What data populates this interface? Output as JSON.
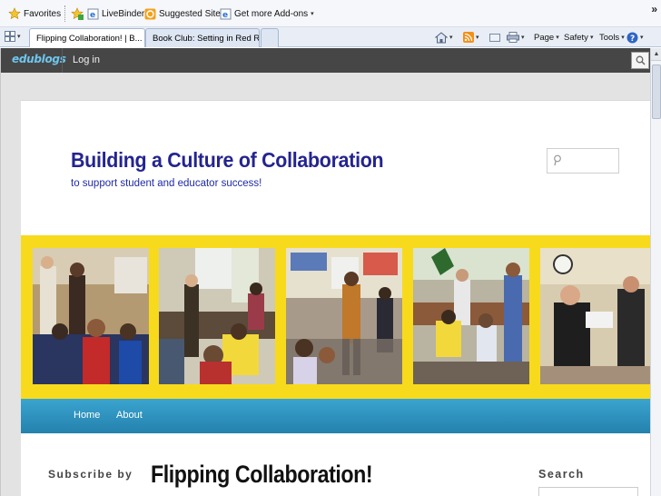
{
  "favorites_bar": {
    "favorites_label": "Favorites",
    "livebinder_label": "LiveBinder It",
    "suggested_sites_label": "Suggested Sites",
    "addons_label": "Get more Add-ons",
    "more_glyph": "»"
  },
  "tabs": [
    {
      "label": "Flipping Collaboration! | B...",
      "close": "✕",
      "active": true
    },
    {
      "label": "Book Club: Setting in Red Ro...",
      "active": false
    }
  ],
  "command_bar": {
    "page_label": "Page",
    "safety_label": "Safety",
    "tools_label": "Tools",
    "dropdown_glyph": "▾"
  },
  "admin_bar": {
    "logo_text": "edublogs",
    "login_label": "Log in"
  },
  "site": {
    "title": "Building a Culture of Collaboration",
    "tagline": "to support student and educator success!",
    "nav": [
      "Home",
      "About"
    ],
    "subscribe_heading": "Subscribe by",
    "post_title": "Flipping Collaboration!",
    "search_heading": "Search"
  },
  "colors": {
    "admin_bar": "#464646",
    "title_blue": "#24248f",
    "banner_yellow": "#f8da1c",
    "nav_blue": "#2a8fbe"
  }
}
